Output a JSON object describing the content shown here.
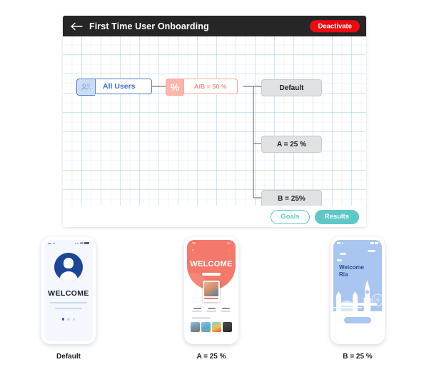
{
  "header": {
    "back_icon": "arrow-left-icon",
    "title": "First Time User Onboarding",
    "deactivate_label": "Deactivate"
  },
  "flow": {
    "nodes": {
      "audience": {
        "icon": "users-icon",
        "label": "All Users"
      },
      "split": {
        "icon": "percent-icon",
        "icon_glyph": "%",
        "label": "A/B = 50 %"
      },
      "outputs": [
        {
          "label": "Default"
        },
        {
          "label": "A = 25 %"
        },
        {
          "label": "B = 25%"
        }
      ]
    }
  },
  "footer": {
    "goals_label": "Goals",
    "results_label": "Results"
  },
  "previews": [
    {
      "caption": "Default",
      "variant": "default",
      "screen_title": "WELCOME",
      "page_dots": 3,
      "active_dot": 1
    },
    {
      "caption": "A = 25 %",
      "variant": "a",
      "screen_title": "WELCOME",
      "thumbnails": 4,
      "stats": 3
    },
    {
      "caption": "B = 25 %",
      "variant": "b",
      "screen_title": "Welcome",
      "screen_subtitle": "Ria"
    }
  ],
  "colors": {
    "header_bg": "#262626",
    "deactivate": "#ee0a10",
    "audience_accent": "#4f7fd6",
    "split_accent": "#f9a79d",
    "output_bg": "#e0e1e2",
    "teal": "#5ec8c8",
    "grid_line": "#96c8eb"
  }
}
